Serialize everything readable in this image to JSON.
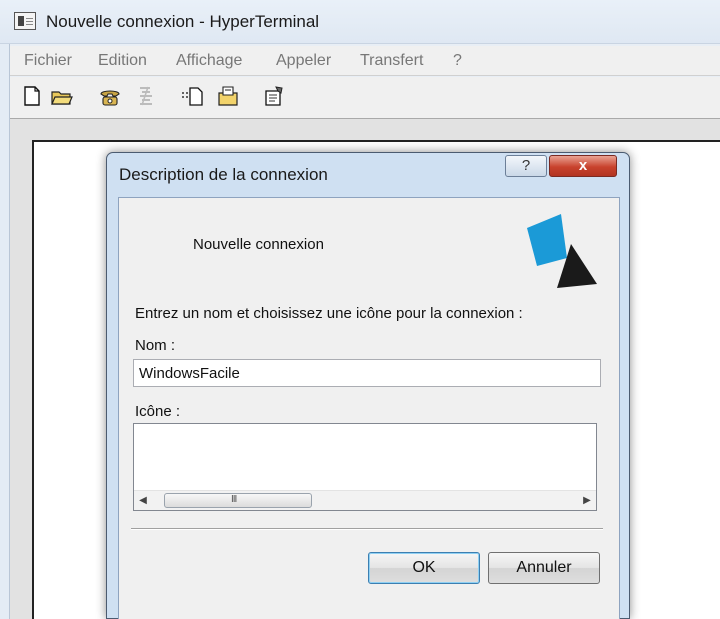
{
  "window": {
    "title": "Nouvelle connexion - HyperTerminal"
  },
  "menu": {
    "items": [
      "Fichier",
      "Edition",
      "Affichage",
      "Appeler",
      "Transfert",
      "?"
    ]
  },
  "toolbar": {
    "icons": [
      "new-document-icon",
      "open-folder-icon",
      "phone-connect-icon",
      "phone-disconnect-icon",
      "send-file-icon",
      "receive-file-icon",
      "properties-icon"
    ]
  },
  "dialog": {
    "title": "Description de la connexion",
    "help_label": "?",
    "close_label": "x",
    "connection_name": "Nouvelle connexion",
    "prompt": "Entrez un nom et choisissez une icône pour la connexion :",
    "name_label": "Nom :",
    "name_value": "WindowsFacile",
    "icon_label": "Icône :",
    "scroll_grip": "III",
    "ok_label": "OK",
    "cancel_label": "Annuler"
  },
  "colors": {
    "logo_blue": "#1b9ad7",
    "logo_black": "#1a1a1a",
    "close_red": "#c8422d"
  }
}
